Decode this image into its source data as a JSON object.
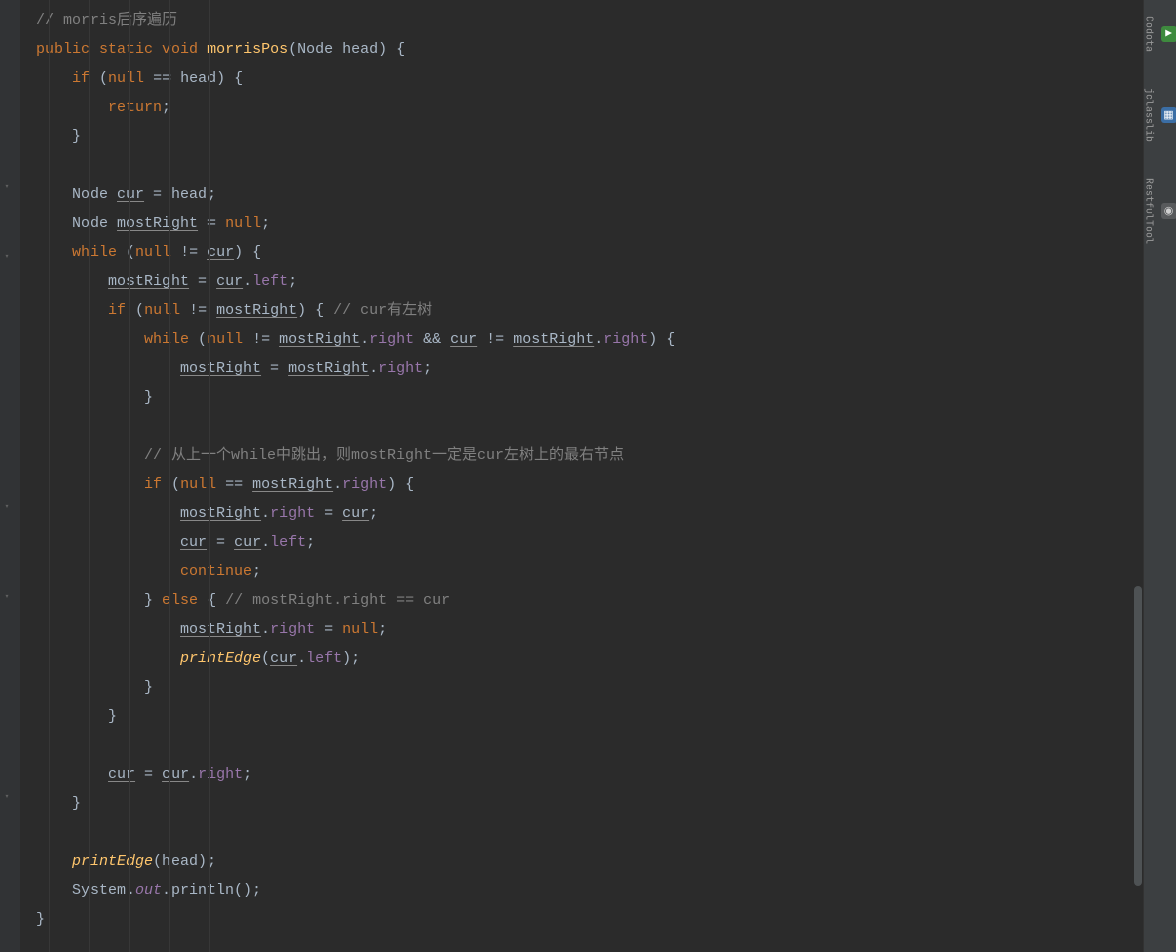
{
  "rail": {
    "items": [
      {
        "name": "codota",
        "label": "Codota",
        "iconClass": "ic-green",
        "iconGlyph": "▶"
      },
      {
        "name": "jclasslib",
        "label": "jclasslib",
        "iconClass": "ic-blue",
        "iconGlyph": "▦"
      },
      {
        "name": "restfultool",
        "label": "RestfulTool",
        "iconClass": "ic-grey",
        "iconGlyph": "◉"
      }
    ]
  },
  "scroll": {
    "thumbTop": 586,
    "thumbHeight": 300
  },
  "code": {
    "lines": [
      [
        [
          "sp",
          "    "
        ],
        [
          "cm",
          "// morris后序遍历"
        ]
      ],
      [
        [
          "sp",
          "    "
        ],
        [
          "kw",
          "public "
        ],
        [
          "kw",
          "static "
        ],
        [
          "kw",
          "void "
        ],
        [
          "mtd",
          "morrisPos"
        ],
        [
          "sym",
          "(Node head) {"
        ]
      ],
      [
        [
          "sp",
          "        "
        ],
        [
          "kw",
          "if "
        ],
        [
          "sym",
          "("
        ],
        [
          "kw",
          "null "
        ],
        [
          "sym",
          "== head) {"
        ]
      ],
      [
        [
          "sp",
          "            "
        ],
        [
          "kw",
          "return"
        ],
        [
          "sym",
          ";"
        ]
      ],
      [
        [
          "sp",
          "        "
        ],
        [
          "sym",
          "}"
        ]
      ],
      [
        [
          "sp",
          ""
        ]
      ],
      [
        [
          "sp",
          "        "
        ],
        [
          "sym",
          "Node "
        ],
        [
          "u",
          "cur"
        ],
        [
          "sym",
          " = head;"
        ]
      ],
      [
        [
          "sp",
          "        "
        ],
        [
          "sym",
          "Node "
        ],
        [
          "u",
          "mostRight"
        ],
        [
          "sym",
          " = "
        ],
        [
          "kw",
          "null"
        ],
        [
          "sym",
          ";"
        ]
      ],
      [
        [
          "sp",
          "        "
        ],
        [
          "kw",
          "while "
        ],
        [
          "sym",
          "("
        ],
        [
          "kw",
          "null "
        ],
        [
          "sym",
          "!= "
        ],
        [
          "u",
          "cur"
        ],
        [
          "sym",
          ") {"
        ]
      ],
      [
        [
          "sp",
          "            "
        ],
        [
          "u",
          "mostRight"
        ],
        [
          "sym",
          " = "
        ],
        [
          "u",
          "cur"
        ],
        [
          "sym",
          "."
        ],
        [
          "fld",
          "left"
        ],
        [
          "sym",
          ";"
        ]
      ],
      [
        [
          "sp",
          "            "
        ],
        [
          "kw",
          "if "
        ],
        [
          "sym",
          "("
        ],
        [
          "kw",
          "null "
        ],
        [
          "sym",
          "!= "
        ],
        [
          "u",
          "mostRight"
        ],
        [
          "sym",
          ") { "
        ],
        [
          "cm",
          "// cur有左树"
        ]
      ],
      [
        [
          "sp",
          "                "
        ],
        [
          "kw",
          "while "
        ],
        [
          "sym",
          "("
        ],
        [
          "kw",
          "null "
        ],
        [
          "sym",
          "!= "
        ],
        [
          "u",
          "mostRight"
        ],
        [
          "sym",
          "."
        ],
        [
          "fld",
          "right"
        ],
        [
          "sym",
          " && "
        ],
        [
          "u",
          "cur"
        ],
        [
          "sym",
          " != "
        ],
        [
          "u",
          "mostRight"
        ],
        [
          "sym",
          "."
        ],
        [
          "fld",
          "right"
        ],
        [
          "sym",
          ") {"
        ]
      ],
      [
        [
          "sp",
          "                    "
        ],
        [
          "u",
          "mostRight"
        ],
        [
          "sym",
          " = "
        ],
        [
          "u",
          "mostRight"
        ],
        [
          "sym",
          "."
        ],
        [
          "fld",
          "right"
        ],
        [
          "sym",
          ";"
        ]
      ],
      [
        [
          "sp",
          "                "
        ],
        [
          "sym",
          "}"
        ]
      ],
      [
        [
          "sp",
          ""
        ]
      ],
      [
        [
          "sp",
          "                "
        ],
        [
          "cm",
          "// 从上一个while中跳出，则mostRight一定是cur左树上的最右节点"
        ]
      ],
      [
        [
          "sp",
          "                "
        ],
        [
          "kw",
          "if "
        ],
        [
          "sym",
          "("
        ],
        [
          "kw",
          "null "
        ],
        [
          "sym",
          "== "
        ],
        [
          "u",
          "mostRight"
        ],
        [
          "sym",
          "."
        ],
        [
          "fld",
          "right"
        ],
        [
          "sym",
          ") {"
        ]
      ],
      [
        [
          "sp",
          "                    "
        ],
        [
          "u",
          "mostRight"
        ],
        [
          "sym",
          "."
        ],
        [
          "fld",
          "right"
        ],
        [
          "sym",
          " = "
        ],
        [
          "u",
          "cur"
        ],
        [
          "sym",
          ";"
        ]
      ],
      [
        [
          "sp",
          "                    "
        ],
        [
          "u",
          "cur"
        ],
        [
          "sym",
          " = "
        ],
        [
          "u",
          "cur"
        ],
        [
          "sym",
          "."
        ],
        [
          "fld",
          "left"
        ],
        [
          "sym",
          ";"
        ]
      ],
      [
        [
          "sp",
          "                    "
        ],
        [
          "kw",
          "continue"
        ],
        [
          "sym",
          ";"
        ]
      ],
      [
        [
          "sp",
          "                "
        ],
        [
          "sym",
          "} "
        ],
        [
          "kw",
          "else "
        ],
        [
          "sym",
          "{ "
        ],
        [
          "cm",
          "// mostRight.right == cur"
        ]
      ],
      [
        [
          "sp",
          "                    "
        ],
        [
          "u",
          "mostRight"
        ],
        [
          "sym",
          "."
        ],
        [
          "fld",
          "right"
        ],
        [
          "sym",
          " = "
        ],
        [
          "kw",
          "null"
        ],
        [
          "sym",
          ";"
        ]
      ],
      [
        [
          "sp",
          "                    "
        ],
        [
          "mtdi",
          "printEdge"
        ],
        [
          "sym",
          "("
        ],
        [
          "u",
          "cur"
        ],
        [
          "sym",
          "."
        ],
        [
          "fld",
          "left"
        ],
        [
          "sym",
          ");"
        ]
      ],
      [
        [
          "sp",
          "                "
        ],
        [
          "sym",
          "}"
        ]
      ],
      [
        [
          "sp",
          "            "
        ],
        [
          "sym",
          "}"
        ]
      ],
      [
        [
          "sp",
          ""
        ]
      ],
      [
        [
          "sp",
          "            "
        ],
        [
          "u",
          "cur"
        ],
        [
          "sym",
          " = "
        ],
        [
          "u",
          "cur"
        ],
        [
          "sym",
          "."
        ],
        [
          "fld",
          "right"
        ],
        [
          "sym",
          ";"
        ]
      ],
      [
        [
          "sp",
          "        "
        ],
        [
          "sym",
          "}"
        ]
      ],
      [
        [
          "sp",
          ""
        ]
      ],
      [
        [
          "sp",
          "        "
        ],
        [
          "mtdi",
          "printEdge"
        ],
        [
          "sym",
          "(head);"
        ]
      ],
      [
        [
          "sp",
          "        "
        ],
        [
          "sym",
          "System."
        ],
        [
          "fldi",
          "out"
        ],
        [
          "sym",
          ".println();"
        ]
      ],
      [
        [
          "sp",
          "    "
        ],
        [
          "sym",
          "}"
        ]
      ]
    ]
  },
  "guides": [
    49,
    89,
    129,
    169,
    209
  ],
  "folds": [
    180,
    250,
    500,
    590,
    790
  ],
  "tokenClasses": {
    "sp": "",
    "cm": "tok-cm",
    "kw": "tok-kw",
    "mtd": "tok-mtd",
    "mtdi": "tok-mtdi",
    "fldi": "tok-fldi",
    "sym": "tok-sym",
    "u": "tok-u tok-sym",
    "fld": "tok-fld"
  }
}
